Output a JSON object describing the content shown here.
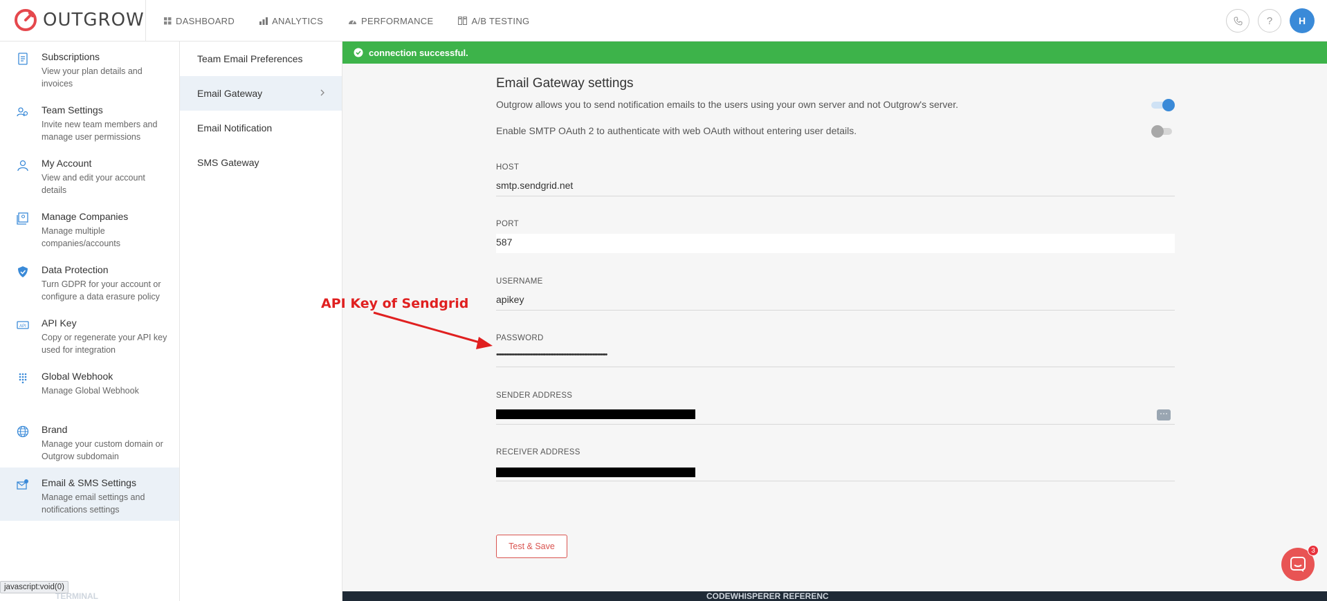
{
  "brand": {
    "name": "OUTGROW"
  },
  "nav": [
    {
      "label": "DASHBOARD",
      "icon": "grid-icon"
    },
    {
      "label": "ANALYTICS",
      "icon": "bar-chart-icon"
    },
    {
      "label": "PERFORMANCE",
      "icon": "gauge-icon"
    },
    {
      "label": "A/B TESTING",
      "icon": "split-test-icon"
    }
  ],
  "top_right": {
    "help": "?",
    "avatar_initial": "H"
  },
  "sidebar": [
    {
      "title": "Subscriptions",
      "desc": "View your plan details and invoices",
      "icon": "document-icon"
    },
    {
      "title": "Team Settings",
      "desc": "Invite new team members and manage user permissions",
      "icon": "team-icon"
    },
    {
      "title": "My Account",
      "desc": "View and edit your account details",
      "icon": "user-icon"
    },
    {
      "title": "Manage Companies",
      "desc": "Manage multiple companies/accounts",
      "icon": "companies-icon"
    },
    {
      "title": "Data Protection",
      "desc": "Turn GDPR for your account or configure a data erasure policy",
      "icon": "shield-icon"
    },
    {
      "title": "API Key",
      "desc": "Copy or regenerate your API key used for integration",
      "icon": "api-icon"
    },
    {
      "title": "Global Webhook",
      "desc": "Manage Global Webhook",
      "icon": "dots-grid-icon"
    },
    {
      "title": "Brand",
      "desc": "Manage your custom domain or Outgrow subdomain",
      "icon": "globe-icon"
    },
    {
      "title": "Email & SMS Settings",
      "desc": "Manage email settings and notifications settings",
      "icon": "email-settings-icon"
    }
  ],
  "subnav": [
    {
      "label": "Team Email Preferences"
    },
    {
      "label": "Email Gateway"
    },
    {
      "label": "Email Notification"
    },
    {
      "label": "SMS Gateway"
    }
  ],
  "banner": {
    "text": "connection successful."
  },
  "settings": {
    "title": "Email Gateway settings",
    "own_server_text": "Outgrow allows you to send notification emails to the users using your own server and not Outgrow's server.",
    "oauth_text": "Enable SMTP OAuth 2 to authenticate with web OAuth without entering user details."
  },
  "fields": {
    "host_label": "HOST",
    "host_value": "smtp.sendgrid.net",
    "port_label": "PORT",
    "port_value": "587",
    "username_label": "USERNAME",
    "username_value": "apikey",
    "password_label": "PASSWORD",
    "password_value": "••••••••••••••••••••••••••••••••••••••••••••••••••••••••••••••••••••",
    "sender_label": "SENDER ADDRESS",
    "receiver_label": "RECEIVER ADDRESS"
  },
  "save_button": "Test & Save",
  "annotation": "API Key of Sendgrid",
  "status_tip": "javascript:void(0)",
  "chat_badge": "3",
  "bottom_strip": {
    "left": "TERMINAL",
    "middle": "CODEWHISPERER REFERENC"
  },
  "colors": {
    "brand_red": "#e5484d",
    "success": "#3db34a",
    "accent_blue": "#3a8ad8"
  }
}
